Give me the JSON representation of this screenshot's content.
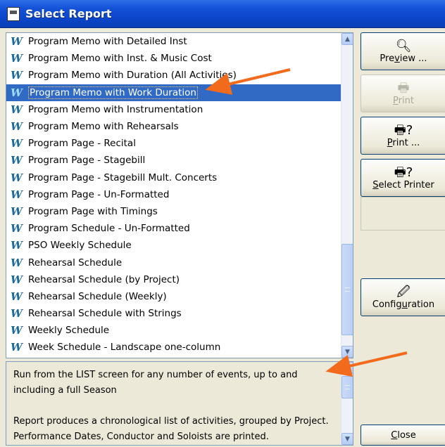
{
  "window": {
    "title": "Select Report"
  },
  "report_list": {
    "selected_index": 3,
    "items": [
      "Program Memo with Detailed Inst",
      "Program Memo with Inst. & Music Cost",
      "Program Memo with Duration (All Activities)",
      "Program Memo with Work Duration",
      "Program Memo with Instrumentation",
      "Program Memo with Rehearsals",
      "Program Page - Recital",
      "Program Page - Stagebill",
      "Program Page - Stagebill Mult. Concerts",
      "Program Page - Un-Formatted",
      "Program Page with Timings",
      "Program Schedule - Un-Formatted",
      "PSO Weekly Schedule",
      "Rehearsal Schedule",
      "Rehearsal Schedule (by Project)",
      "Rehearsal Schedule (Weekly)",
      "Rehearsal Schedule with Strings",
      "Weekly Schedule",
      "Week Schedule - Landscape one-column"
    ],
    "item_icon": "word-document-icon",
    "item_glyph": "W"
  },
  "description": {
    "paragraph1": "Run from the LIST screen for any number of events, up to and including a full Season",
    "paragraph2": "Report produces a chronological list of activities, grouped by Project. Performance Dates, Conductor and Soloists are printed."
  },
  "buttons": {
    "preview": {
      "prefix": "Pre",
      "accel": "v",
      "suffix": "iew ...",
      "icon": "preview-icon",
      "glyph": "🔍︎"
    },
    "print": {
      "prefix": "",
      "accel": "P",
      "suffix": "rint",
      "icon": "printer-icon",
      "glyph": "🖶",
      "disabled": true
    },
    "print_dialog": {
      "prefix": "",
      "accel": "P",
      "suffix": "rint ...",
      "icon": "printer-question-icon",
      "glyph": "🖶?"
    },
    "select_printer": {
      "prefix": "",
      "accel": "S",
      "suffix": "elect Printer",
      "icon": "printer-question-icon",
      "glyph": "🖶?"
    },
    "configuration": {
      "prefix": "Config",
      "accel": "u",
      "suffix": "ration",
      "icon": "configuration-icon",
      "glyph": "🖉"
    },
    "close": {
      "prefix": "",
      "accel": "C",
      "suffix": "lose"
    }
  },
  "annotations": {
    "arrow_color": "#f26b1d"
  },
  "colors": {
    "selection": "#316ac5",
    "titlebar": "#0a45c8"
  }
}
